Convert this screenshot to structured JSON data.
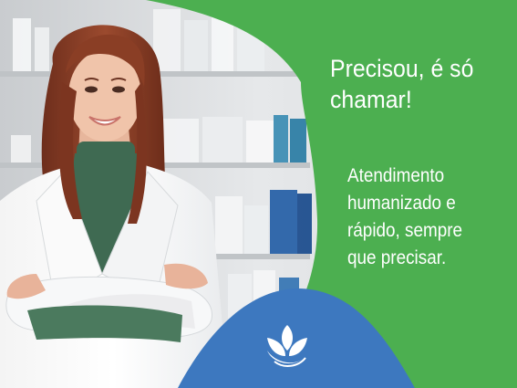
{
  "banner": {
    "headline": "Precisou, é só\nchamar!",
    "subline": "Atendimento\nhumanizado e\nrápido, sempre\nque precisar."
  },
  "colors": {
    "green_panel": "#4caf50",
    "blue_panel": "#3d78bf",
    "white_text": "#ffffff"
  },
  "icons": {
    "logo": "leaf-logo-icon"
  }
}
